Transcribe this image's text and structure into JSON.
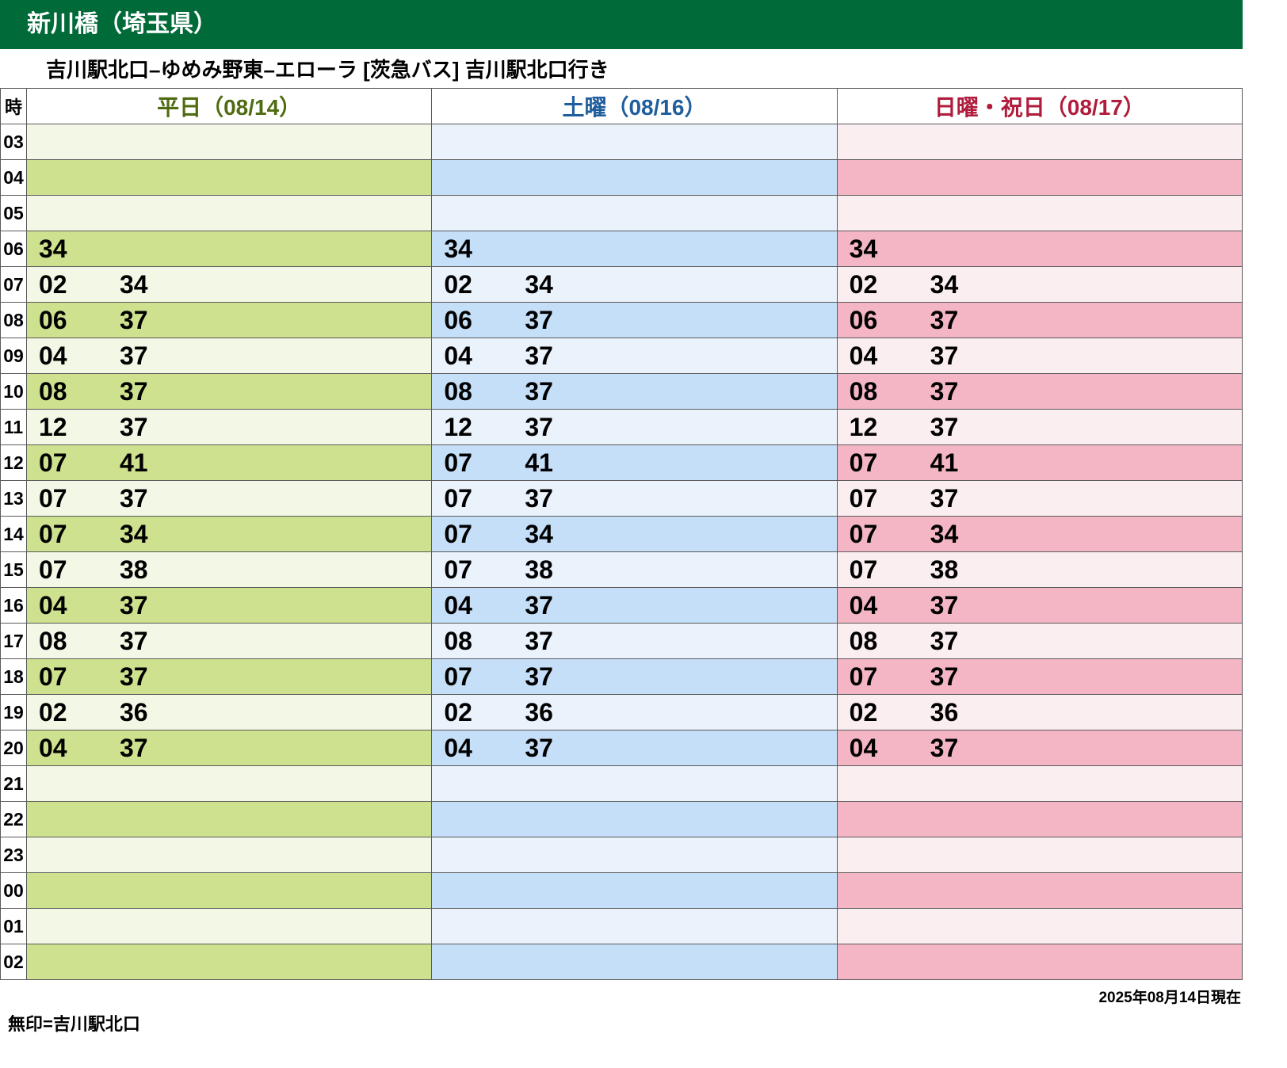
{
  "header": {
    "title": "新川橋（埼玉県）"
  },
  "route": {
    "text": "吉川駅北口–ゆめみ野東–エローラ [茨急バス]  吉川駅北口行き"
  },
  "table": {
    "hour_header": "時",
    "columns": [
      {
        "label": "平日（08/14）",
        "color": "#4f6b12",
        "bg_light": "#f3f8e6",
        "bg_dark": "#cde18e"
      },
      {
        "label": "土曜（08/16）",
        "color": "#1f5d9c",
        "bg_light": "#eaf2fc",
        "bg_dark": "#c6dff9"
      },
      {
        "label": "日曜・祝日（08/17）",
        "color": "#b01c3c",
        "bg_light": "#fbeef1",
        "bg_dark": "#f4b6c5"
      }
    ],
    "rows": [
      {
        "hour": "03",
        "weekday": [],
        "saturday": [],
        "holiday": []
      },
      {
        "hour": "04",
        "weekday": [],
        "saturday": [],
        "holiday": []
      },
      {
        "hour": "05",
        "weekday": [],
        "saturday": [],
        "holiday": []
      },
      {
        "hour": "06",
        "weekday": [
          "34"
        ],
        "saturday": [
          "34"
        ],
        "holiday": [
          "34"
        ]
      },
      {
        "hour": "07",
        "weekday": [
          "02",
          "34"
        ],
        "saturday": [
          "02",
          "34"
        ],
        "holiday": [
          "02",
          "34"
        ]
      },
      {
        "hour": "08",
        "weekday": [
          "06",
          "37"
        ],
        "saturday": [
          "06",
          "37"
        ],
        "holiday": [
          "06",
          "37"
        ]
      },
      {
        "hour": "09",
        "weekday": [
          "04",
          "37"
        ],
        "saturday": [
          "04",
          "37"
        ],
        "holiday": [
          "04",
          "37"
        ]
      },
      {
        "hour": "10",
        "weekday": [
          "08",
          "37"
        ],
        "saturday": [
          "08",
          "37"
        ],
        "holiday": [
          "08",
          "37"
        ]
      },
      {
        "hour": "11",
        "weekday": [
          "12",
          "37"
        ],
        "saturday": [
          "12",
          "37"
        ],
        "holiday": [
          "12",
          "37"
        ]
      },
      {
        "hour": "12",
        "weekday": [
          "07",
          "41"
        ],
        "saturday": [
          "07",
          "41"
        ],
        "holiday": [
          "07",
          "41"
        ]
      },
      {
        "hour": "13",
        "weekday": [
          "07",
          "37"
        ],
        "saturday": [
          "07",
          "37"
        ],
        "holiday": [
          "07",
          "37"
        ]
      },
      {
        "hour": "14",
        "weekday": [
          "07",
          "34"
        ],
        "saturday": [
          "07",
          "34"
        ],
        "holiday": [
          "07",
          "34"
        ]
      },
      {
        "hour": "15",
        "weekday": [
          "07",
          "38"
        ],
        "saturday": [
          "07",
          "38"
        ],
        "holiday": [
          "07",
          "38"
        ]
      },
      {
        "hour": "16",
        "weekday": [
          "04",
          "37"
        ],
        "saturday": [
          "04",
          "37"
        ],
        "holiday": [
          "04",
          "37"
        ]
      },
      {
        "hour": "17",
        "weekday": [
          "08",
          "37"
        ],
        "saturday": [
          "08",
          "37"
        ],
        "holiday": [
          "08",
          "37"
        ]
      },
      {
        "hour": "18",
        "weekday": [
          "07",
          "37"
        ],
        "saturday": [
          "07",
          "37"
        ],
        "holiday": [
          "07",
          "37"
        ]
      },
      {
        "hour": "19",
        "weekday": [
          "02",
          "36"
        ],
        "saturday": [
          "02",
          "36"
        ],
        "holiday": [
          "02",
          "36"
        ]
      },
      {
        "hour": "20",
        "weekday": [
          "04",
          "37"
        ],
        "saturday": [
          "04",
          "37"
        ],
        "holiday": [
          "04",
          "37"
        ]
      },
      {
        "hour": "21",
        "weekday": [],
        "saturday": [],
        "holiday": []
      },
      {
        "hour": "22",
        "weekday": [],
        "saturday": [],
        "holiday": []
      },
      {
        "hour": "23",
        "weekday": [],
        "saturday": [],
        "holiday": []
      },
      {
        "hour": "00",
        "weekday": [],
        "saturday": [],
        "holiday": []
      },
      {
        "hour": "01",
        "weekday": [],
        "saturday": [],
        "holiday": []
      },
      {
        "hour": "02",
        "weekday": [],
        "saturday": [],
        "holiday": []
      }
    ]
  },
  "footer": {
    "as_of": "2025年08月14日現在",
    "legend": "無印=吉川駅北口"
  }
}
